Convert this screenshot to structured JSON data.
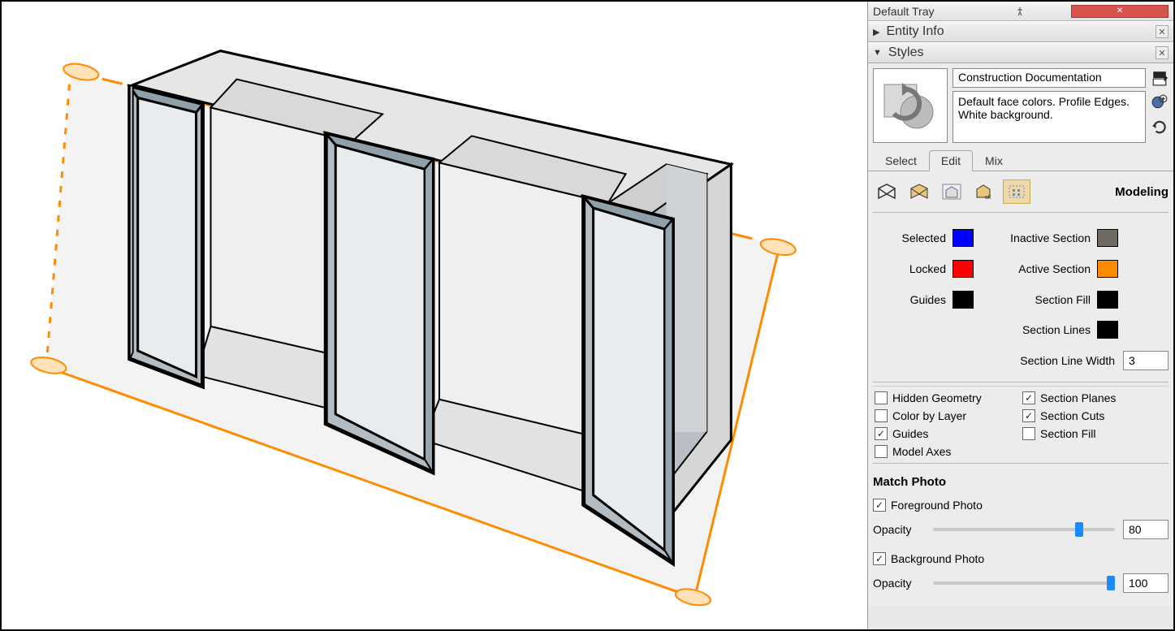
{
  "tray": {
    "title": "Default Tray",
    "panels": [
      {
        "name": "Entity Info",
        "expanded": false
      },
      {
        "name": "Styles",
        "expanded": true
      }
    ]
  },
  "styles": {
    "name": "Construction Documentation",
    "description": "Default face colors. Profile Edges. White background.",
    "tabs": [
      "Select",
      "Edit",
      "Mix"
    ],
    "active_tab": "Edit",
    "toolbar_label": "Modeling",
    "colors": {
      "selected": {
        "label": "Selected",
        "hex": "#0000ff"
      },
      "locked": {
        "label": "Locked",
        "hex": "#ff0000"
      },
      "guides": {
        "label": "Guides",
        "hex": "#000000"
      },
      "inactive_section": {
        "label": "Inactive Section",
        "hex": "#6f6a62"
      },
      "active_section": {
        "label": "Active Section",
        "hex": "#ff8c00"
      },
      "section_fill": {
        "label": "Section Fill",
        "hex": "#000000"
      },
      "section_lines": {
        "label": "Section Lines",
        "hex": "#000000"
      }
    },
    "section_line_width": {
      "label": "Section Line Width",
      "value": "3"
    },
    "checks": {
      "hidden_geometry": {
        "label": "Hidden Geometry",
        "checked": false
      },
      "color_by_layer": {
        "label": "Color by Layer",
        "checked": false
      },
      "guides": {
        "label": "Guides",
        "checked": true
      },
      "model_axes": {
        "label": "Model Axes",
        "checked": false
      },
      "section_planes": {
        "label": "Section Planes",
        "checked": true
      },
      "section_cuts": {
        "label": "Section Cuts",
        "checked": true
      },
      "section_fill": {
        "label": "Section Fill",
        "checked": false
      }
    },
    "match_photo": {
      "title": "Match Photo",
      "foreground": {
        "label": "Foreground Photo",
        "checked": true,
        "opacity_label": "Opacity",
        "opacity": "80"
      },
      "background": {
        "label": "Background Photo",
        "checked": true,
        "opacity_label": "Opacity",
        "opacity": "100"
      }
    }
  }
}
